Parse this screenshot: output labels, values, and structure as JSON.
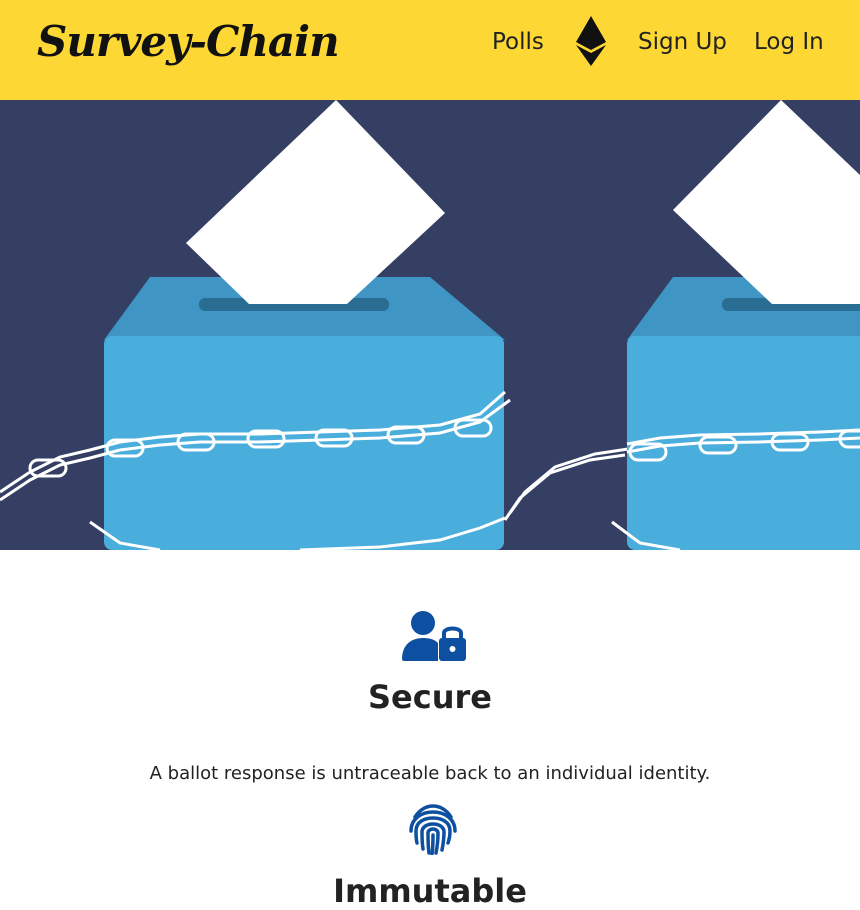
{
  "navbar": {
    "brand": "Survey-Chain",
    "links": {
      "polls": "Polls",
      "signup": "Sign Up",
      "login": "Log In"
    },
    "background_color": "#fdd835",
    "ethereum_icon": "ethereum-icon"
  },
  "hero": {
    "image": "ballot-box-chained-illustration",
    "background_color": "#353f64",
    "box_color": "#4aaedc"
  },
  "features": [
    {
      "icon": "user-lock-icon",
      "title": "Secure",
      "description": "A ballot response is untraceable back to an individual identity."
    },
    {
      "icon": "fingerprint-icon",
      "title": "Immutable"
    }
  ],
  "icon_color": "#0d4fa0"
}
